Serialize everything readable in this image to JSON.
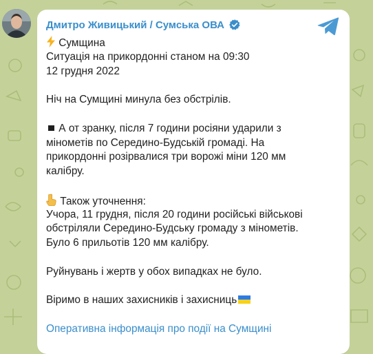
{
  "channel": {
    "sender_name": "Дмитро Живицький / Сумська ОВА",
    "verified_icon": "verified-badge-icon",
    "share_icon": "telegram-plane-icon"
  },
  "message": {
    "header_title": "Сумщина",
    "header_line_1": "Ситуація на прикордонні станом на 09:30",
    "header_line_2": "12 грудня 2022",
    "night_line": "Ніч на Сумщині минула без обстрілів.",
    "morning_line_1": "А от зранку, після 7 години росіяни ударили з",
    "morning_line_2": "мінометів по Середино-Будській громаді. На",
    "morning_line_3": "прикордонні розірвалися три ворожі міни 120 мм",
    "morning_line_4": "калібру.",
    "clarify_title": "Також уточнення:",
    "clarify_line_1": "Учора, 11 грудня, після 20 години російські військові",
    "clarify_line_2": "обстріляли Середино-Будську громаду з мінометів.",
    "clarify_line_3": "Було 6 прильотів 120 мм калібру.",
    "damage_line": "Руйнувань і жертв у обох випадках не було.",
    "believe_line": "Віримо в наших захисників і захисниць",
    "link_text": "Оперативна інформація про події на Сумщині"
  },
  "colors": {
    "background": "#c4d29a",
    "bubble": "#ffffff",
    "accent": "#3a8ecb",
    "text": "#1f1f1f"
  }
}
